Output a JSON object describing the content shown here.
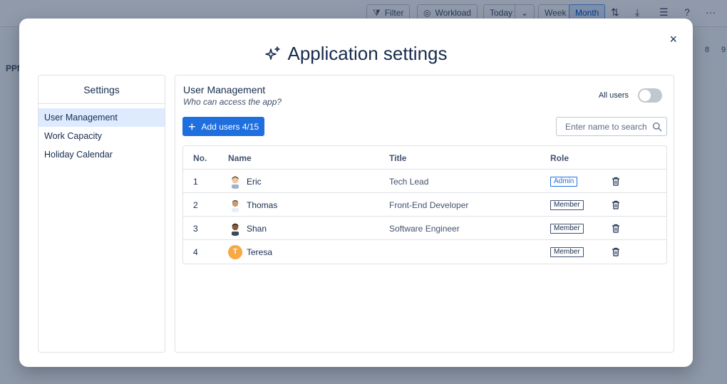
{
  "background": {
    "toolbar": {
      "filter_label": "Filter",
      "workload_label": "Workload",
      "today_label": "Today",
      "week_label": "Week",
      "month_label": "Month",
      "help_label": "?",
      "more_label": "···"
    },
    "row_label": "PPM",
    "column_numbers": [
      "8",
      "9"
    ]
  },
  "modal": {
    "title": "Application settings",
    "close_label": "×",
    "sidebar": {
      "title": "Settings",
      "items": [
        {
          "label": "User Management",
          "selected": true
        },
        {
          "label": "Work Capacity",
          "selected": false
        },
        {
          "label": "Holiday Calendar",
          "selected": false
        }
      ]
    },
    "user_management": {
      "title": "User Management",
      "subtitle": "Who can access the app?",
      "all_users_label": "All users",
      "all_users_enabled": false,
      "add_button_label": "Add users 4/15",
      "search_placeholder": "Enter name to search",
      "table": {
        "headers": {
          "no": "No.",
          "name": "Name",
          "title": "Title",
          "role": "Role"
        },
        "rows": [
          {
            "no": "1",
            "name": "Eric",
            "title": "Tech Lead",
            "role": "Admin",
            "avatar": "person-avatar-icon"
          },
          {
            "no": "2",
            "name": "Thomas",
            "title": "Front-End Developer",
            "role": "Member",
            "avatar": "person-avatar-icon"
          },
          {
            "no": "3",
            "name": "Shan",
            "title": "Software Engineer",
            "role": "Member",
            "avatar": "person-avatar-icon"
          },
          {
            "no": "4",
            "name": "Teresa",
            "title": "",
            "role": "Member",
            "avatar_letter": "T"
          }
        ]
      }
    }
  },
  "colors": {
    "primary": "#1f6fde",
    "selected_bg": "#deebff",
    "avatar_letter_bg": "#f6a945"
  }
}
